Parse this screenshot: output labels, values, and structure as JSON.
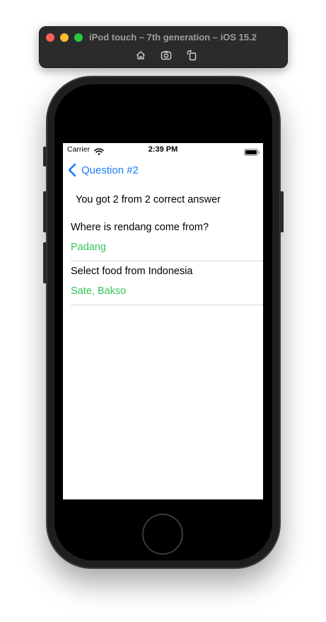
{
  "window": {
    "title": "iPod touch – 7th generation – iOS 15.2",
    "toolbar_icons": [
      "home-icon",
      "screenshot-icon",
      "rotate-icon"
    ]
  },
  "status_bar": {
    "carrier": "Carrier",
    "time": "2:39 PM"
  },
  "nav": {
    "back_label": "Question #2"
  },
  "result": {
    "score_text": "You got 2 from 2 correct answer"
  },
  "answers": [
    {
      "question": "Where is rendang come from?",
      "answer": "Padang"
    },
    {
      "question": "Select food from Indonesia",
      "answer": "Sate, Bakso"
    }
  ],
  "colors": {
    "accent": "#1a7cf5",
    "correct": "#34c759"
  }
}
